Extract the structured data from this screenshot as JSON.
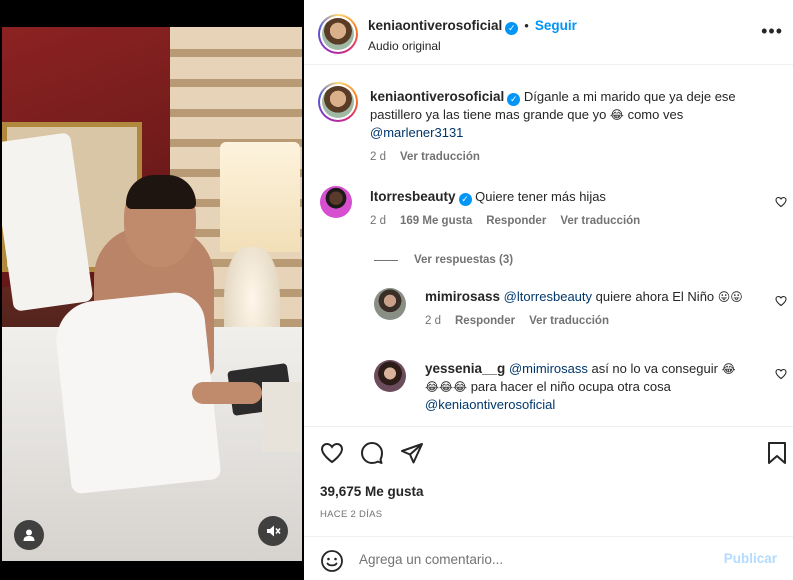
{
  "post": {
    "author": "keniaontiverosoficial",
    "follow_label": "Seguir",
    "dot": "•",
    "audio": "Audio original",
    "more_icon": "•••"
  },
  "caption": {
    "username": "keniaontiverosoficial",
    "text_part1": "Díganle a mi marido que ya deje ese pastillero ya las tiene mas grande que yo ",
    "emoji": "😂",
    "text_part2": " como ves ",
    "mention": "@marlener3131",
    "time": "2 d",
    "translate": "Ver traducción"
  },
  "comments": [
    {
      "username": "ltorresbeauty",
      "verified": true,
      "text": "Quiere tener más hijas",
      "time": "2 d",
      "likes": "169 Me gusta",
      "reply": "Responder",
      "translate": "Ver traducción"
    }
  ],
  "view_replies": "Ver respuestas (3)",
  "replies": [
    {
      "username": "mimirosass",
      "mention": "@ltorresbeauty",
      "text": " quiere ahora El Niño ",
      "emoji": "😛😛",
      "time": "2 d",
      "reply": "Responder",
      "translate": "Ver traducción"
    },
    {
      "username": "yessenia__g",
      "mention": "@mimirosass",
      "text": " así no lo va conseguir ",
      "emoji1": "😂",
      "emoji2": "😂😂😂",
      "text2": " para hacer el niño ocupa otra cosa",
      "mention2": "@keniaontiverosoficial"
    }
  ],
  "stats": {
    "likes": "39,675 Me gusta",
    "ago": "HACE 2 DÍAS"
  },
  "composer": {
    "placeholder": "Agrega un comentario...",
    "post_label": "Publicar"
  },
  "colors": {
    "accent": "#0095f6",
    "publish_disabled": "#b3dbff",
    "secondary_text": "#737373"
  }
}
